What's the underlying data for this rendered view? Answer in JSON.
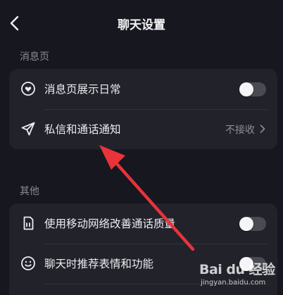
{
  "header": {
    "title": "聊天设置"
  },
  "sections": [
    {
      "label": "消息页",
      "rows": [
        {
          "label": "消息页展示日常",
          "icon": "heart-circle-icon",
          "control": "toggle",
          "toggle_on": false
        },
        {
          "label": "私信和通话通知",
          "icon": "send-icon",
          "control": "link",
          "value": "不接收"
        }
      ]
    },
    {
      "label": "其他",
      "rows": [
        {
          "label": "使用移动网络改善通话质量",
          "icon": "sim-card-icon",
          "control": "toggle",
          "toggle_on": false
        },
        {
          "label": "聊天时推荐表情和功能",
          "icon": "smiley-icon",
          "control": "toggle",
          "toggle_on": false
        }
      ]
    }
  ],
  "watermark": {
    "logo": "Bai du 经验",
    "url": "jingyan.baidu.com"
  },
  "colors": {
    "background": "#17171f",
    "card": "#22222b",
    "annotation_arrow": "#e8333a"
  }
}
